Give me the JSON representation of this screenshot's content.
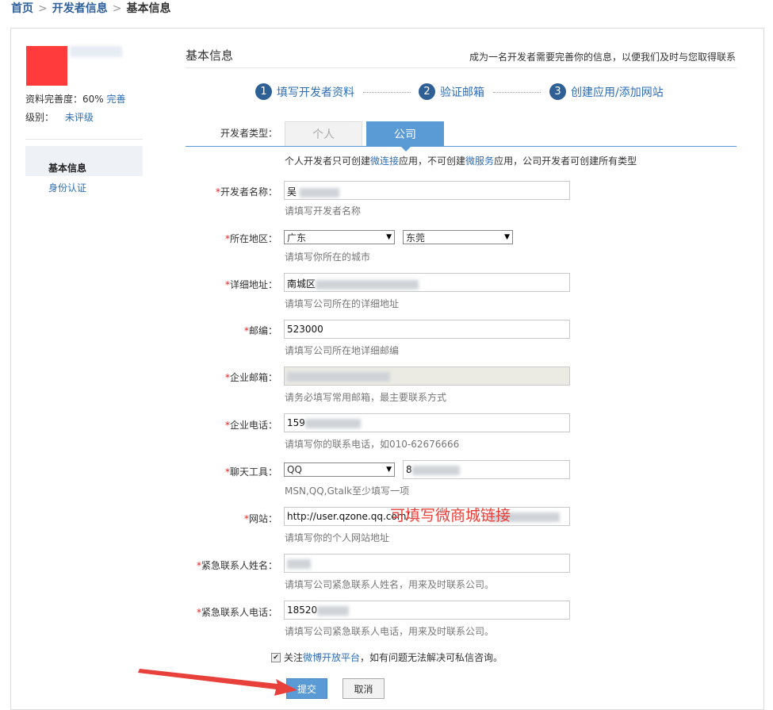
{
  "breadcrumb": {
    "home": "首页",
    "dev": "开发者信息",
    "current": "基本信息",
    "sep": ">"
  },
  "sidebar": {
    "completeness_label": "资料完善度：60%",
    "complete_link": "完善",
    "level_label": "级别：",
    "level_value": "未评级",
    "items": [
      {
        "label": "基本信息"
      },
      {
        "label": "身份认证"
      }
    ]
  },
  "header": {
    "title": "基本信息",
    "note": "成为一名开发者需要完善你的信息，以便我们及时与您取得联系"
  },
  "steps": [
    {
      "num": "1",
      "label": "填写开发者资料"
    },
    {
      "num": "2",
      "label": "验证邮箱"
    },
    {
      "num": "3",
      "label": "创建应用/添加网站"
    }
  ],
  "dev_type": {
    "label": "开发者类型：",
    "tab_personal": "个人",
    "tab_company": "公司",
    "note_prefix": "个人开发者只可创建",
    "note_link1": "微连接",
    "note_mid": "应用，不可创建",
    "note_link2": "微服务",
    "note_suffix": "应用，公司开发者可创建所有类型"
  },
  "req": "*",
  "fields": {
    "name": {
      "label": "开发者名称：",
      "value": "吴",
      "hint": "请填写开发者名称"
    },
    "region": {
      "label": "所在地区：",
      "province": "广东",
      "city": "东莞",
      "hint": "请填写你所在的城市"
    },
    "address": {
      "label": "详细地址：",
      "value": "南城区",
      "hint": "请填写公司所在的详细地址"
    },
    "zip": {
      "label": "邮编：",
      "value": "523000",
      "hint": "请填写公司所在地详细邮编"
    },
    "email": {
      "label": "企业邮箱：",
      "hint": "请务必填写常用邮箱，最主要联系方式"
    },
    "phone": {
      "label": "企业电话：",
      "value": "159",
      "hint": "请填写你的联系电话，如010-62676666"
    },
    "chat": {
      "label": "聊天工具：",
      "tool": "QQ",
      "value": "8",
      "hint": "MSN,QQ,Gtalk至少填写一项"
    },
    "website": {
      "label": "网站：",
      "value": "http://user.qzone.qq.com/",
      "hint": "请填写你的个人网站地址"
    },
    "emergency_name": {
      "label": "紧急联系人姓名：",
      "hint": "请填写公司紧急联系人姓名，用来及时联系公司。"
    },
    "emergency_phone": {
      "label": "紧急联系人电话：",
      "value": "18520",
      "hint": "请填写公司紧急联系人电话，用来及时联系公司。"
    }
  },
  "annotation": "可填写微商城链接",
  "agree": {
    "prefix": "关注",
    "link": "微博开放平台",
    "suffix": "，如有问题无法解决可私信咨询。"
  },
  "buttons": {
    "submit": "提交",
    "cancel": "取消"
  },
  "colors": {
    "accent": "#5b9bd5",
    "link": "#2d6db5",
    "step": "#2e5f95",
    "annotation": "#e8403a",
    "required": "#e02020"
  }
}
